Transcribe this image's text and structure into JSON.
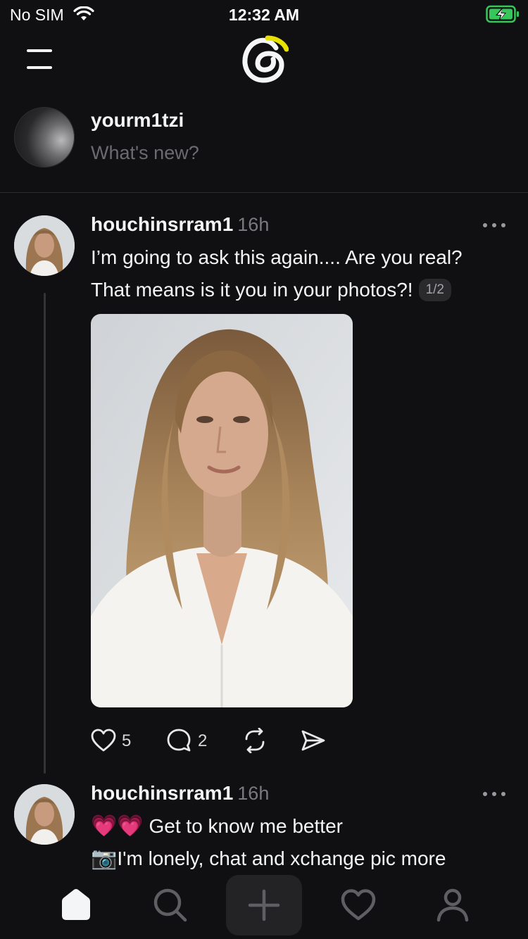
{
  "status_bar": {
    "carrier": "No SIM",
    "time": "12:32 AM"
  },
  "composer": {
    "username": "yourm1tzi",
    "placeholder": "What's new?"
  },
  "posts": [
    {
      "username": "houchinsrram1",
      "time": "16h",
      "text_line1": "I’m going to ask this again.... Are you real?",
      "text_line2": "That means is it you in your photos?!",
      "pager": "1/2",
      "likes": "5",
      "replies": "2"
    },
    {
      "username": "houchinsrram1",
      "time": "16h",
      "emoji_hearts": "💗💗",
      "text_line1": "Get to know me better",
      "emoji_camera": "📷",
      "text_line2": "I'm lonely, chat and xchange pic more"
    }
  ],
  "colors": {
    "background": "#101012",
    "text": "#f3f5f7",
    "muted": "#7a7a7e",
    "logo_accent": "#e8e000",
    "battery_green": "#35c759"
  }
}
